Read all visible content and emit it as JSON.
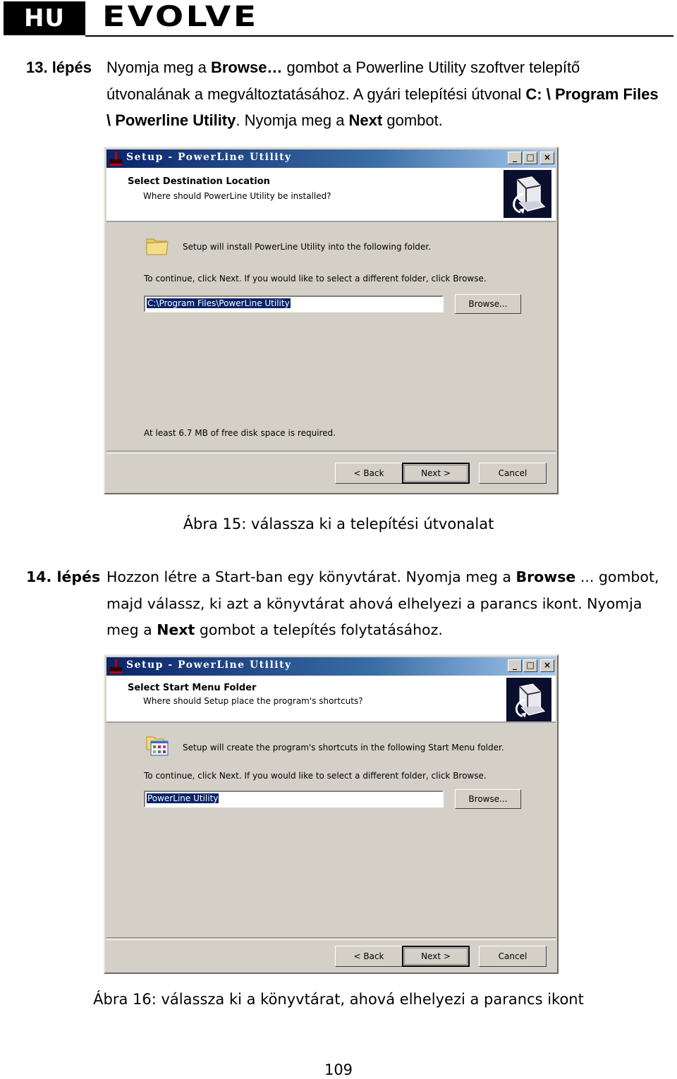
{
  "header": {
    "language_badge": "HU",
    "brand": "EVOLVE"
  },
  "steps": [
    {
      "number": "13. lépés",
      "segments": [
        {
          "text": "Nyomja meg a ",
          "bold": false
        },
        {
          "text": "Browse…",
          "bold": true
        },
        {
          "text": " gombot a Powerline Utility szoftver telepítő útvonalának a megváltoztatásához. A gyári telepítési útvonal ",
          "bold": false
        },
        {
          "text": "C: \\ Program Files \\ Powerline Utility",
          "bold": true
        },
        {
          "text": ". Nyomja meg a ",
          "bold": false
        },
        {
          "text": "Next",
          "bold": true
        },
        {
          "text": " gombot.",
          "bold": false
        }
      ]
    },
    {
      "number": "14. lépés",
      "segments": [
        {
          "text": "Hozzon létre a Start-ban egy könyvtárat. Nyomja meg a ",
          "bold": false
        },
        {
          "text": "Browse",
          "bold": true
        },
        {
          "text": " ... gombot, majd válassz, ki azt a könyvtárat ahová elhelyezi a parancs ikont. Nyomja meg a ",
          "bold": false
        },
        {
          "text": "Next",
          "bold": true
        },
        {
          "text": " gombot a telepítés folytatásához.",
          "bold": false
        }
      ]
    }
  ],
  "dialogs": [
    {
      "title": "Setup - PowerLine Utility",
      "heading": "Select Destination Location",
      "subheading": "Where should PowerLine Utility be installed?",
      "icon": "folder-icon",
      "message": "Setup will install PowerLine Utility into the following folder.",
      "instruction": "To continue, click Next. If you would like to select a different folder, click Browse.",
      "input_value": "C:\\Program Files\\PowerLine Utility",
      "browse_label": "Browse...",
      "space_message": "At least 6.7 MB of free disk space is required.",
      "back_label": "< Back",
      "next_label": "Next >",
      "cancel_label": "Cancel",
      "window_buttons": {
        "minimize": "_",
        "maximize": "□",
        "close": "×"
      }
    },
    {
      "title": "Setup - PowerLine Utility",
      "heading": "Select Start Menu Folder",
      "subheading": "Where should Setup place the program's shortcuts?",
      "icon": "start-menu-folder-icon",
      "message": "Setup will create the program's shortcuts in the following Start Menu folder.",
      "instruction": "To continue, click Next. If you would like to select a different folder, click Browse.",
      "input_value": "PowerLine Utility",
      "browse_label": "Browse...",
      "back_label": "< Back",
      "next_label": "Next >",
      "cancel_label": "Cancel",
      "window_buttons": {
        "minimize": "_",
        "maximize": "□",
        "close": "×"
      }
    }
  ],
  "captions": [
    "Ábra 15: válassza ki a telepítési útvonalat",
    "Ábra 16: válassza ki a könyvtárat, ahová elhelyezi a parancs ikont"
  ],
  "page_number": "109",
  "colors": {
    "titlebar_start": "#0a246a",
    "titlebar_end": "#a6caf0",
    "dialog_bg": "#d4d0c8",
    "selection": "#0a246a"
  }
}
